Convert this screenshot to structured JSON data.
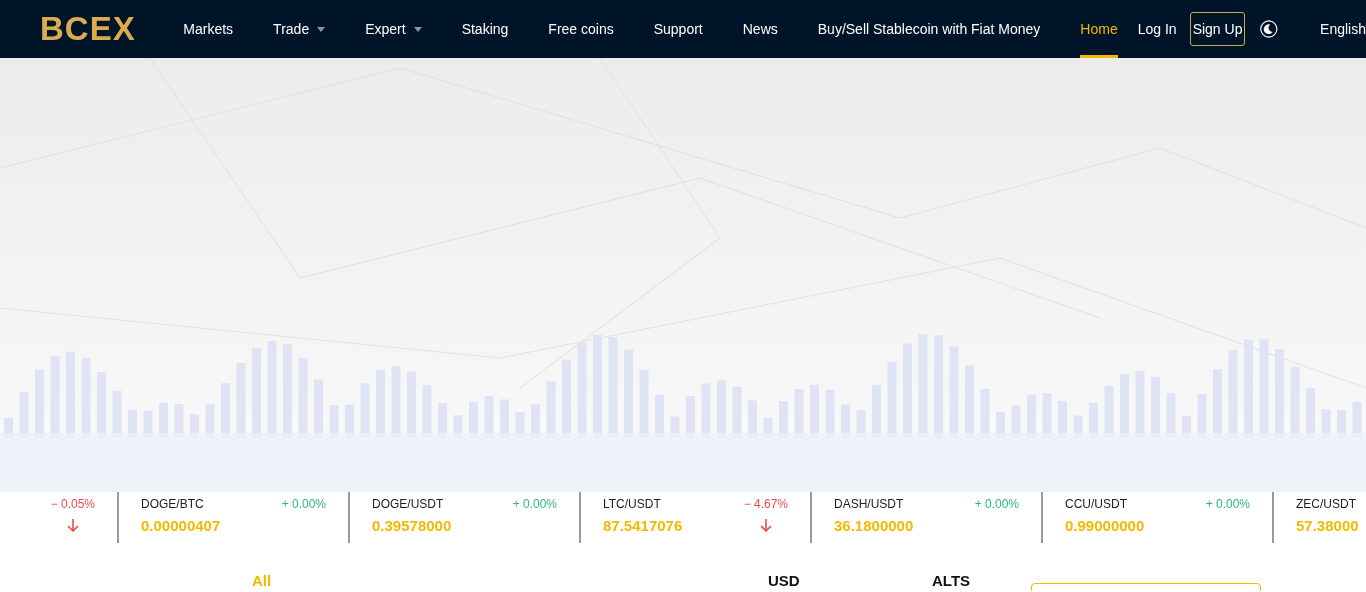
{
  "header": {
    "logo": "BCEX",
    "nav": [
      {
        "label": "Markets",
        "dropdown": false,
        "selected": false
      },
      {
        "label": "Trade",
        "dropdown": true,
        "selected": false
      },
      {
        "label": "Expert",
        "dropdown": true,
        "selected": false
      },
      {
        "label": "Staking",
        "dropdown": false,
        "selected": false
      },
      {
        "label": "Free coins",
        "dropdown": false,
        "selected": false
      },
      {
        "label": "Support",
        "dropdown": false,
        "selected": false
      },
      {
        "label": "News",
        "dropdown": false,
        "selected": false
      },
      {
        "label": "Buy/Sell Stablecoin with Fiat Money",
        "dropdown": false,
        "selected": false
      },
      {
        "label": "Home",
        "dropdown": false,
        "selected": true
      }
    ],
    "login": "Log In",
    "signup": "Sign Up",
    "language": "English"
  },
  "ticker": [
    {
      "change": "− 0.05%",
      "falling": true
    },
    {
      "pair": "DOGE/BTC",
      "change": "+ 0.00%",
      "price": "0.00000407",
      "falling": false
    },
    {
      "pair": "DOGE/USDT",
      "change": "+ 0.00%",
      "price": "0.39578000",
      "falling": false
    },
    {
      "pair": "LTC/USDT",
      "change": "− 4.67%",
      "price": "87.5417076",
      "falling": true
    },
    {
      "pair": "DASH/USDT",
      "change": "+ 0.00%",
      "price": "36.1800000",
      "falling": false
    },
    {
      "pair": "CCU/USDT",
      "change": "+ 0.00%",
      "price": "0.99000000",
      "falling": false
    },
    {
      "pair": "ZEC/USDT",
      "price": "57.38000"
    }
  ],
  "market_tabs": [
    {
      "label": "All",
      "selected": true
    },
    {
      "label": "USD",
      "selected": false
    },
    {
      "label": "ALTS",
      "selected": false
    }
  ]
}
